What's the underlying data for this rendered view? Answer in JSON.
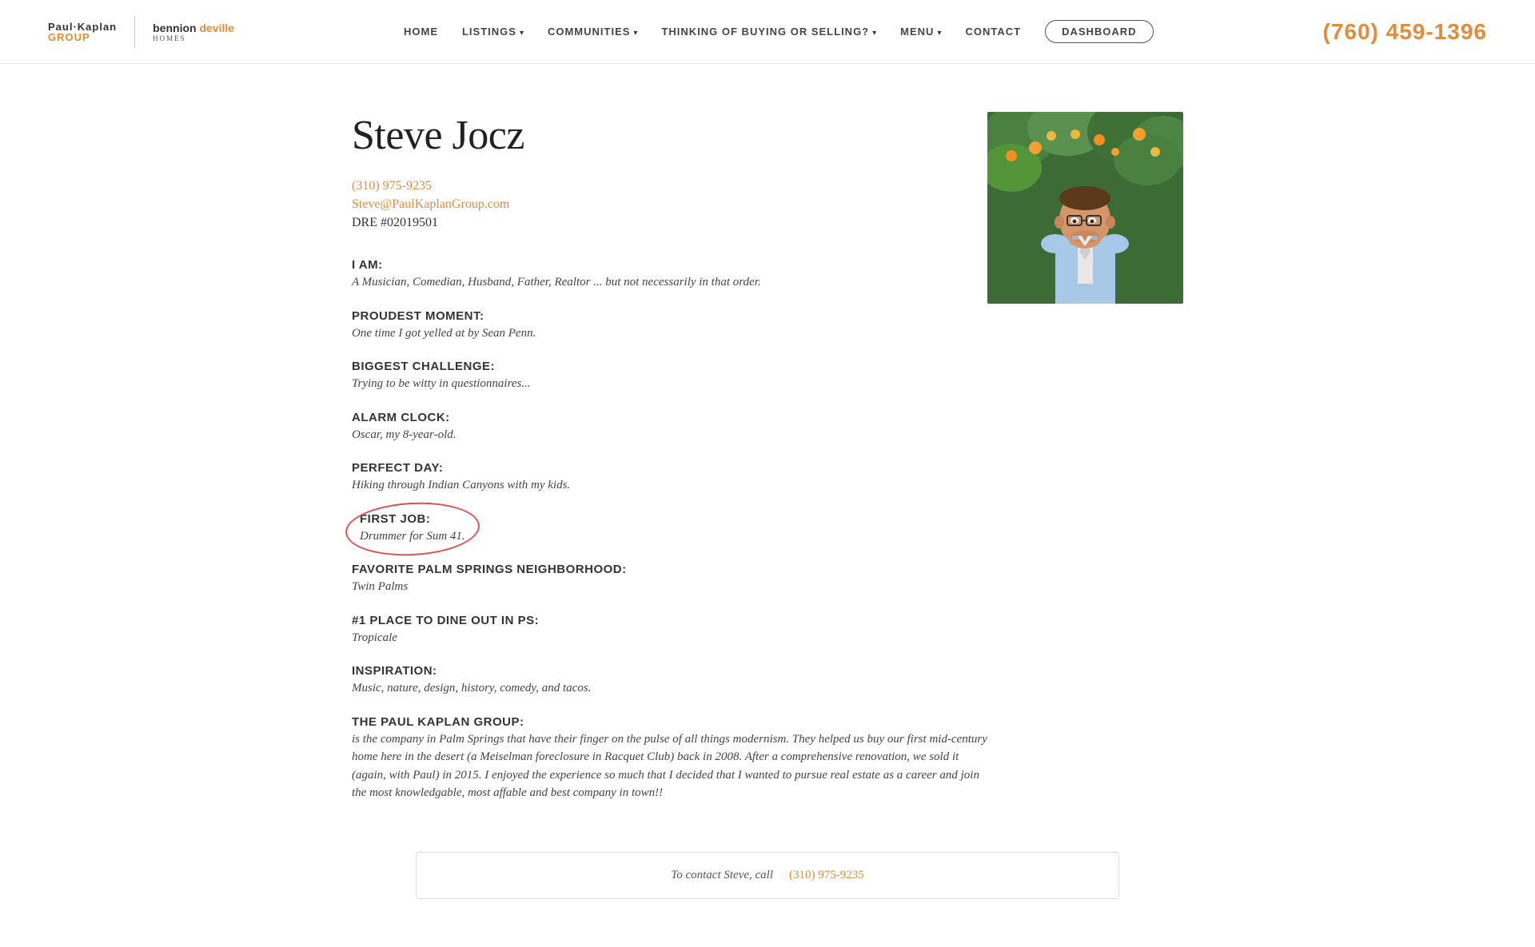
{
  "nav": {
    "logo": {
      "paul_kaplan_top": "Paul·Kaplan",
      "paul_kaplan_group": "GROUP",
      "bennion": "bennion",
      "deville": "deville",
      "homes": "HOMES"
    },
    "links": [
      {
        "label": "HOME",
        "has_dropdown": false,
        "id": "home"
      },
      {
        "label": "LISTINGS",
        "has_dropdown": true,
        "id": "listings"
      },
      {
        "label": "COMMUNITIES",
        "has_dropdown": true,
        "id": "communities"
      },
      {
        "label": "THINKING OF BUYING OR SELLING?",
        "has_dropdown": true,
        "id": "buying-selling"
      },
      {
        "label": "MENU",
        "has_dropdown": true,
        "id": "menu"
      },
      {
        "label": "CONTACT",
        "has_dropdown": false,
        "id": "contact"
      }
    ],
    "dashboard_label": "DASHBOARD",
    "phone": "(760) 459-1396"
  },
  "profile": {
    "name": "Steve Jocz",
    "phone": "(310) 975-9235",
    "email": "Steve@PaulKaplanGroup.com",
    "dre": "DRE #02019501"
  },
  "qa": [
    {
      "id": "i-am",
      "label": "I AM:",
      "answer": "A Musician, Comedian, Husband, Father, Realtor ... but not necessarily in that order.",
      "highlighted": false
    },
    {
      "id": "proudest-moment",
      "label": "PROUDEST MOMENT:",
      "answer": "One time I got yelled at by Sean Penn.",
      "highlighted": false
    },
    {
      "id": "biggest-challenge",
      "label": "BIGGEST CHALLENGE:",
      "answer": "Trying to be witty in questionnaires...",
      "highlighted": false
    },
    {
      "id": "alarm-clock",
      "label": "ALARM CLOCK:",
      "answer": "Oscar, my 8-year-old.",
      "highlighted": false
    },
    {
      "id": "perfect-day",
      "label": "PERFECT DAY:",
      "answer": "Hiking through Indian Canyons with my kids.",
      "highlighted": false
    },
    {
      "id": "first-job",
      "label": "FIRST JOB:",
      "answer": "Drummer for Sum 41.",
      "highlighted": true
    },
    {
      "id": "favorite-neighborhood",
      "label": "FAVORITE PALM SPRINGS NEIGHBORHOOD:",
      "answer": "Twin Palms",
      "highlighted": false
    },
    {
      "id": "dine-out",
      "label": "#1 PLACE TO DINE OUT IN PS:",
      "answer": "Tropicale",
      "highlighted": false
    },
    {
      "id": "inspiration",
      "label": "INSPIRATION:",
      "answer": "Music, nature, design, history, comedy, and tacos.",
      "highlighted": false
    },
    {
      "id": "paul-kaplan-group",
      "label": "THE PAUL KAPLAN GROUP:",
      "answer": "is the company in Palm Springs that have their finger on the pulse of all things modernism. They helped us buy our first mid-century home here in the desert (a Meiselman foreclosure in Racquet Club) back in 2008. After a comprehensive renovation, we sold it (again, with Paul) in 2015. I enjoyed the experience so much that I decided that I wanted to pursue real estate as a career and join the most knowledgable, most affable and best company in town!!",
      "highlighted": false
    }
  ],
  "footer": {
    "contact_text": "To contact Steve, call",
    "contact_phone": "(310) 975-9235"
  },
  "colors": {
    "accent": "#e08c3b",
    "link": "#e08c3b",
    "highlight_ring": "#e05050",
    "text_dark": "#222",
    "text_medium": "#444",
    "nav_link": "#444"
  }
}
